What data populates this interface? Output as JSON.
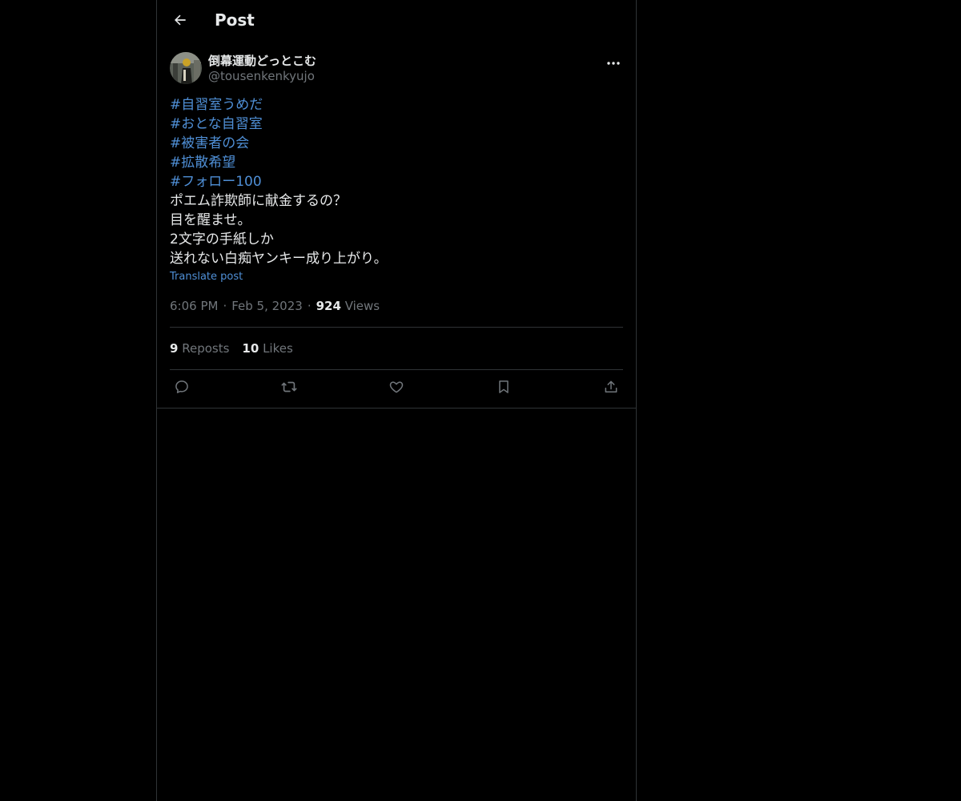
{
  "header": {
    "title": "Post",
    "back_icon": "arrow-left-icon"
  },
  "author": {
    "display_name": "倒幕運動どっとこむ",
    "handle": "@tousenkenkyujo",
    "avatar_icon": "avatar-photo",
    "more_icon": "more-horizontal-icon"
  },
  "post": {
    "hashtags": [
      "#自習室うめだ",
      "#おとな自習室",
      "#被害者の会",
      "#拡散希望",
      "#フォロー100"
    ],
    "lines": [
      "ポエム詐欺師に献金するの？",
      "目を醒ませ。",
      "2文字の手紙しか",
      "送れない白痴ヤンキー成り上がり。"
    ],
    "translate_label": "Translate post",
    "time": "6:06 PM",
    "date": "Feb 5, 2023",
    "views_count": "924",
    "views_label": "Views",
    "separator": "·"
  },
  "stats": {
    "reposts_count": "9",
    "reposts_label": "Reposts",
    "likes_count": "10",
    "likes_label": "Likes"
  },
  "actions": [
    "reply-icon",
    "repost-icon",
    "like-icon",
    "bookmark-icon",
    "share-icon"
  ],
  "colors": {
    "background": "#000000",
    "text": "#e7e9ea",
    "muted": "#71767b",
    "link": "#4f8fd6",
    "border": "#2f3336"
  }
}
